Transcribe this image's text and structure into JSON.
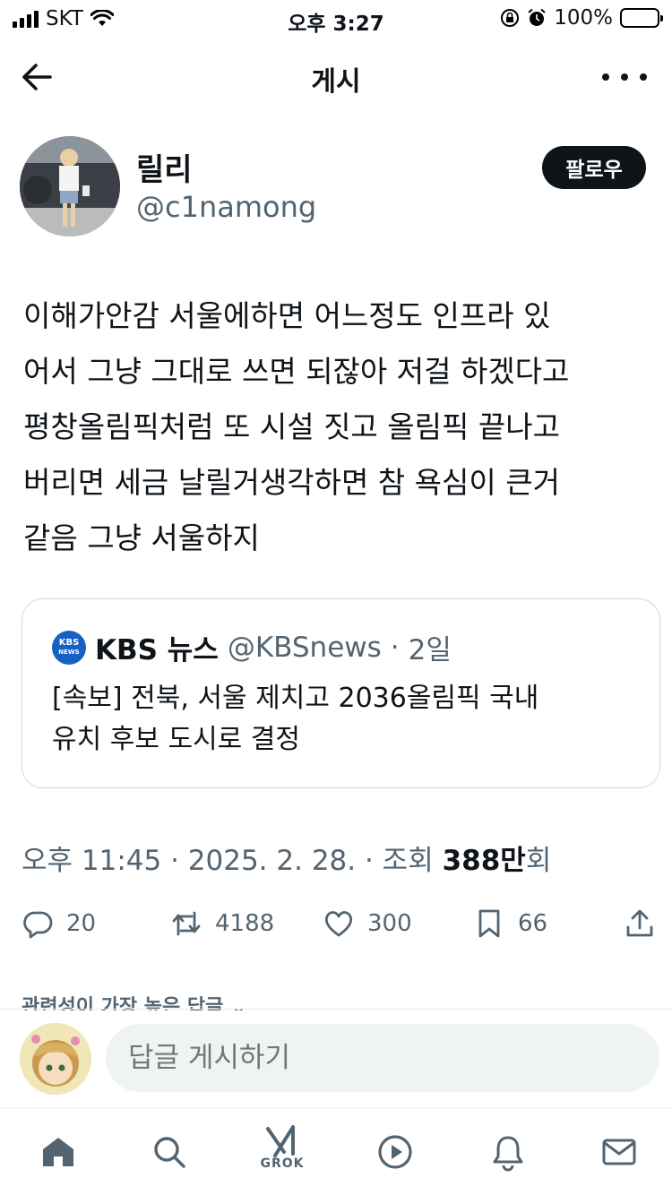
{
  "status_bar": {
    "carrier": "SKT",
    "time": "오후 3:27",
    "battery": "100%",
    "battery_level": 1.0
  },
  "header": {
    "title": "게시",
    "back_icon": "back-arrow-icon",
    "more_icon": "more-dots-icon"
  },
  "author": {
    "name": "릴리",
    "handle": "@c1namong",
    "follow_label": "팔로우"
  },
  "tweet": {
    "text": "이해가안감 서울에하면 어느정도 인프라 있\n어서 그냥 그대로 쓰면 되잖아 저걸 하겠다고\n평창올림픽처럼 또 시설 짓고 올림픽 끝나고\n버리면 세금 날릴거생각하면 참 욕심이 큰거\n같음 그냥 서울하지"
  },
  "quote": {
    "logo_line1": "KBS",
    "logo_line2": "NEWS",
    "name": "KBS 뉴스",
    "handle": "@KBSnews",
    "separator": "·",
    "time": "2일",
    "text": "[속보] 전북, 서울 제치고 2036올림픽 국내\n유치 후보 도시로 결정"
  },
  "meta": {
    "datetime": "오후 11:45 · 2025. 2. 28. · 조회 ",
    "views_num": "388만",
    "views_suffix": "회"
  },
  "actions": {
    "replies": "20",
    "reposts": "4188",
    "likes": "300",
    "bookmarks": "66"
  },
  "section_hint": "관련성이 가장 높은 답글",
  "reply": {
    "placeholder": "답글 게시하기"
  },
  "nav": {
    "grok_label": "GROK"
  }
}
